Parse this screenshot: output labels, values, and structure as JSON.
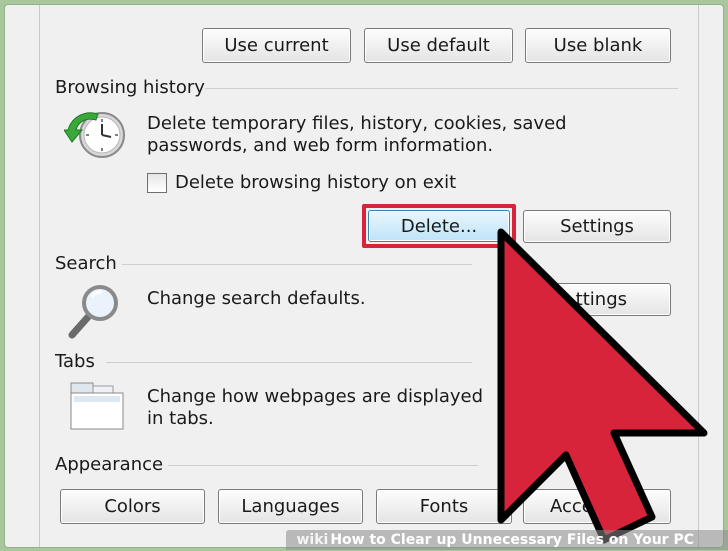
{
  "home_page_buttons": {
    "use_current": "Use current",
    "use_default": "Use default",
    "use_blank": "Use blank"
  },
  "browsing_history": {
    "title": "Browsing history",
    "description": "Delete temporary files, history, cookies, saved passwords, and web form information.",
    "checkbox_label": "Delete browsing history on exit",
    "checkbox_checked": false,
    "delete_label": "Delete...",
    "settings_label": "Settings"
  },
  "search": {
    "title": "Search",
    "description": "Change search defaults.",
    "settings_label": "Settings",
    "settings_visible": "ttings"
  },
  "tabs": {
    "title": "Tabs",
    "description": "Change how webpages are displayed in tabs."
  },
  "appearance": {
    "title": "Appearance",
    "colors_label": "Colors",
    "languages_label": "Languages",
    "fonts_label": "Fonts",
    "accessibility_visible": "Access"
  },
  "overlay": {
    "highlight_color": "#d8243a",
    "arrow_color": "#d8243a",
    "arrow_icon": "arrow-pointer-icon"
  },
  "footer": {
    "brand": "wiki",
    "title": "How to Clear up Unnecessary Files on Your PC"
  }
}
